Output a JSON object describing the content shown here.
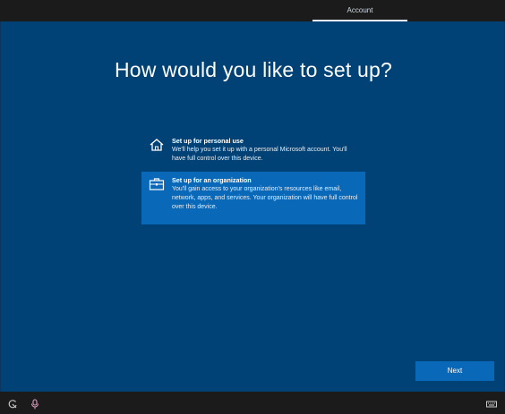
{
  "topbar": {
    "active_tab": "Account"
  },
  "main": {
    "heading": "How would you like to set up?",
    "options": [
      {
        "title": "Set up for personal use",
        "description": "We'll help you set it up with a personal Microsoft account. You'll have full control over this device.",
        "icon": "home-icon",
        "selected": false
      },
      {
        "title": "Set up for an organization",
        "description": "You'll gain access to your organization's resources like email, network, apps, and services. Your organization will have full control over this device.",
        "icon": "briefcase-icon",
        "selected": true
      }
    ],
    "next_label": "Next"
  },
  "bottombar": {
    "icons": [
      "ease-of-access-icon",
      "microphone-icon",
      "keyboard-icon"
    ]
  },
  "colors": {
    "background": "#004275",
    "selected": "#0a68b8",
    "bars": "#1b1b1b"
  }
}
